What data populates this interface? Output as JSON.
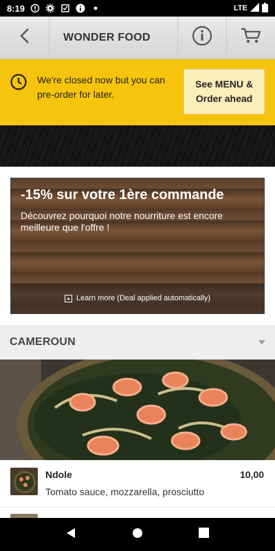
{
  "status_bar": {
    "time": "8:19",
    "network": "LTE"
  },
  "app_bar": {
    "title": "WONDER FOOD",
    "icons": [
      "chevron-left-icon",
      "info-icon",
      "cart-icon"
    ]
  },
  "closed_banner": {
    "message": "We're closed now but you can pre-order for later.",
    "cta_label": "See MENU & Order ahead",
    "color": "#f6c40d"
  },
  "deal": {
    "title": "-15% sur votre 1ère commande",
    "subtitle": "Découvrez pourquoi notre nourriture est encore meilleure que l'offre !",
    "learn_more": "Learn more (Deal applied automatically)"
  },
  "category": {
    "name": "CAMEROUN"
  },
  "menu_items": [
    {
      "name": "Ndole",
      "description": "Tomato sauce, mozzarella, prosciutto",
      "price": "10,00"
    }
  ]
}
